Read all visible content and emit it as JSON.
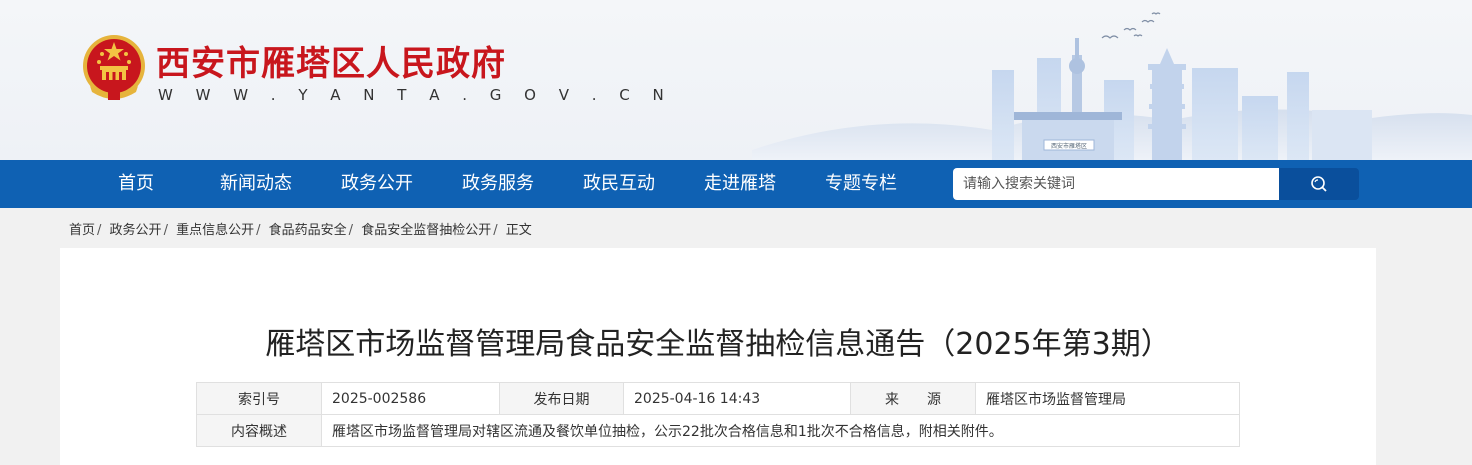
{
  "header": {
    "site_title": "西安市雁塔区人民政府",
    "site_url": "W W W . Y A N T A . G O V . C N",
    "emblem_icon": "national-emblem-icon",
    "skyline_seal_text": "西安市雁塔区"
  },
  "nav": {
    "items": [
      {
        "label": "首页"
      },
      {
        "label": "新闻动态"
      },
      {
        "label": "政务公开"
      },
      {
        "label": "政务服务"
      },
      {
        "label": "政民互动"
      },
      {
        "label": "走进雁塔"
      },
      {
        "label": "专题专栏"
      }
    ],
    "search": {
      "placeholder": "请输入搜索关键词",
      "icon": "search-icon"
    }
  },
  "breadcrumb": {
    "items": [
      "首页",
      "政务公开",
      "重点信息公开",
      "食品药品安全",
      "食品安全监督抽检公开",
      "正文"
    ]
  },
  "article": {
    "title": "雁塔区市场监督管理局食品安全监督抽检信息通告（2025年第3期）",
    "meta": {
      "index_label": "索引号",
      "index_value": "2025-002586",
      "date_label": "发布日期",
      "date_value": "2025-04-16 14:43",
      "source_label": "来　　源",
      "source_value": "雁塔区市场监督管理局",
      "summary_label": "内容概述",
      "summary_value": "雁塔区市场监督管理局对辖区流通及餐饮单位抽检，公示22批次合格信息和1批次不合格信息，附相关附件。"
    }
  },
  "colors": {
    "brand_red": "#c8161d",
    "nav_blue": "#0f61b3",
    "search_button": "#0a4f9c"
  }
}
